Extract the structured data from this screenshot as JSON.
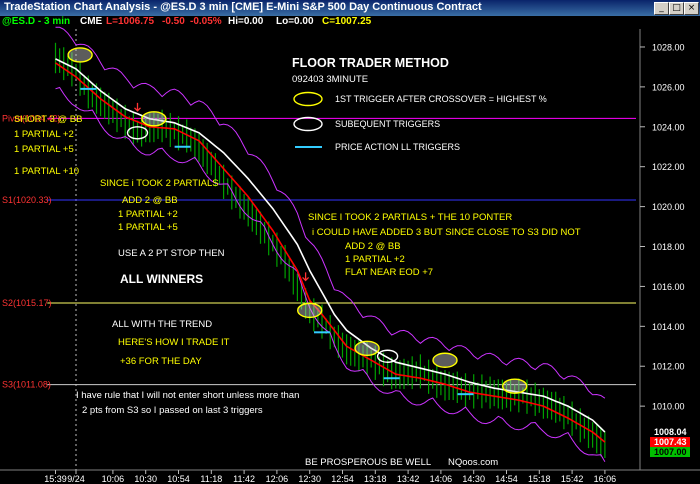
{
  "window": {
    "title": "TradeStation Chart Analysis - @ES.D  3 min  [CME] E-Mini S&P 500 Day Continuous Contract",
    "btn_min": "_",
    "btn_max": "□",
    "btn_close": "×"
  },
  "infobar": {
    "symbol": "@ES.D - 3 min",
    "exchange": "CME",
    "last": "L=1006.75",
    "chg": "-0.50",
    "pct": "-0.05%",
    "hi": "Hi=0.00",
    "lo": "Lo=0.00",
    "close": "C=1007.25"
  },
  "colors": {
    "bg": "#000000",
    "bar": "#00a000",
    "band": "#cc33ff",
    "fast_ma": "#ff0000",
    "slow_ma": "#ffffff",
    "pivot": "#ff3333",
    "text_yellow": "#ffff00",
    "trigger_cyan": "#33ccff"
  },
  "chart_data": {
    "type": "line",
    "title": "FLOOR TRADER METHOD",
    "subtitle": "092403  3MINUTE",
    "ylim": [
      1007,
      1028.5
    ],
    "y_ticks": [
      1028,
      1026,
      1024,
      1022,
      1020,
      1018,
      1016,
      1014,
      1012,
      1010
    ],
    "y_tick_labels": [
      "1028.00",
      "1026.00",
      "1024.00",
      "1022.00",
      "1020.00",
      "1018.00",
      "1016.00",
      "1014.00",
      "1012.00",
      "1010.00"
    ],
    "x_ticks": [
      {
        "label": "15:39",
        "i": -5
      },
      {
        "label": "9/24",
        "i": 0
      },
      {
        "label": "10:06",
        "i": 9
      },
      {
        "label": "10:30",
        "i": 17
      },
      {
        "label": "10:54",
        "i": 25
      },
      {
        "label": "11:18",
        "i": 33
      },
      {
        "label": "11:42",
        "i": 41
      },
      {
        "label": "12:06",
        "i": 49
      },
      {
        "label": "12:30",
        "i": 57
      },
      {
        "label": "12:54",
        "i": 65
      },
      {
        "label": "13:18",
        "i": 73
      },
      {
        "label": "13:42",
        "i": 81
      },
      {
        "label": "14:06",
        "i": 89
      },
      {
        "label": "14:30",
        "i": 97
      },
      {
        "label": "14:54",
        "i": 105
      },
      {
        "label": "15:18",
        "i": 113
      },
      {
        "label": "15:42",
        "i": 121
      },
      {
        "label": "16:06",
        "i": 129
      }
    ],
    "price_anchors": [
      [
        -5,
        1027.5
      ],
      [
        0,
        1026.8
      ],
      [
        3,
        1025.8
      ],
      [
        6,
        1025.3
      ],
      [
        9,
        1024.8
      ],
      [
        12,
        1024.3
      ],
      [
        15,
        1023.8
      ],
      [
        18,
        1024.0
      ],
      [
        21,
        1024.1
      ],
      [
        24,
        1023.8
      ],
      [
        27,
        1023.6
      ],
      [
        30,
        1023.0
      ],
      [
        33,
        1022.2
      ],
      [
        36,
        1021.3
      ],
      [
        39,
        1020.5
      ],
      [
        42,
        1019.8
      ],
      [
        45,
        1019.0
      ],
      [
        48,
        1018.2
      ],
      [
        51,
        1017.3
      ],
      [
        54,
        1016.0
      ],
      [
        57,
        1014.8
      ],
      [
        60,
        1014.3
      ],
      [
        63,
        1013.5
      ],
      [
        66,
        1012.9
      ],
      [
        69,
        1012.6
      ],
      [
        72,
        1012.4
      ],
      [
        75,
        1011.9
      ],
      [
        78,
        1011.6
      ],
      [
        81,
        1011.7
      ],
      [
        84,
        1011.8
      ],
      [
        87,
        1011.4
      ],
      [
        90,
        1011.1
      ],
      [
        93,
        1011.0
      ],
      [
        96,
        1010.8
      ],
      [
        99,
        1010.8
      ],
      [
        102,
        1010.7
      ],
      [
        105,
        1010.6
      ],
      [
        108,
        1010.6
      ],
      [
        111,
        1010.5
      ],
      [
        114,
        1010.2
      ],
      [
        117,
        1010.0
      ],
      [
        120,
        1009.6
      ],
      [
        123,
        1009.1
      ],
      [
        126,
        1008.6
      ],
      [
        129,
        1008.1
      ]
    ],
    "fast_ma_anchors": [
      [
        -5,
        1027.2
      ],
      [
        0,
        1026.5
      ],
      [
        6,
        1025.4
      ],
      [
        12,
        1024.5
      ],
      [
        18,
        1024.0
      ],
      [
        24,
        1023.9
      ],
      [
        30,
        1023.3
      ],
      [
        36,
        1021.9
      ],
      [
        42,
        1020.5
      ],
      [
        48,
        1018.8
      ],
      [
        54,
        1016.8
      ],
      [
        57,
        1015.3
      ],
      [
        60,
        1014.6
      ],
      [
        63,
        1013.8
      ],
      [
        66,
        1013.0
      ],
      [
        72,
        1012.3
      ],
      [
        78,
        1011.6
      ],
      [
        84,
        1011.4
      ],
      [
        90,
        1011.1
      ],
      [
        96,
        1010.7
      ],
      [
        102,
        1010.5
      ],
      [
        108,
        1010.3
      ],
      [
        114,
        1010.0
      ],
      [
        120,
        1009.4
      ],
      [
        126,
        1008.7
      ],
      [
        129,
        1008.2
      ]
    ],
    "slow_ma_anchors": [
      [
        -5,
        1027.4
      ],
      [
        0,
        1026.9
      ],
      [
        6,
        1025.8
      ],
      [
        12,
        1024.9
      ],
      [
        18,
        1024.4
      ],
      [
        24,
        1024.2
      ],
      [
        30,
        1023.7
      ],
      [
        36,
        1022.7
      ],
      [
        42,
        1021.4
      ],
      [
        48,
        1019.9
      ],
      [
        54,
        1018.1
      ],
      [
        57,
        1016.8
      ],
      [
        60,
        1015.7
      ],
      [
        63,
        1014.6
      ],
      [
        66,
        1013.8
      ],
      [
        72,
        1012.9
      ],
      [
        78,
        1012.2
      ],
      [
        84,
        1011.9
      ],
      [
        90,
        1011.6
      ],
      [
        96,
        1011.2
      ],
      [
        102,
        1010.9
      ],
      [
        108,
        1010.7
      ],
      [
        114,
        1010.5
      ],
      [
        120,
        1010.0
      ],
      [
        126,
        1009.3
      ],
      [
        129,
        1008.7
      ]
    ],
    "pivots": [
      {
        "label": "Pivot(1024.42)",
        "value": 1024.42
      },
      {
        "label": "S1(1020.33)",
        "value": 1020.33
      },
      {
        "label": "S2(1015.17)",
        "value": 1015.17
      },
      {
        "label": "S3(1011.08)",
        "value": 1011.08
      }
    ],
    "price_boxes": [
      {
        "value": "1008.04",
        "bg": "#000000",
        "fg": "#ffffff",
        "y": 1008.04
      },
      {
        "value": "1007.43",
        "bg": "#ff0000",
        "fg": "#ffffff",
        "y": 1007.43
      },
      {
        "value": "1007.00",
        "bg": "#00c000",
        "fg": "#000000",
        "y": 1007.0
      }
    ],
    "first_triggers": [
      {
        "i": 1,
        "y": 1027.6
      },
      {
        "i": 19,
        "y": 1024.4
      },
      {
        "i": 57,
        "y": 1014.8
      },
      {
        "i": 71,
        "y": 1012.9
      },
      {
        "i": 90,
        "y": 1012.3
      },
      {
        "i": 107,
        "y": 1011.0
      }
    ],
    "subsequent_triggers": [
      {
        "i": 15,
        "y": 1023.7
      },
      {
        "i": 76,
        "y": 1012.5
      }
    ],
    "cyan_triggers": [
      {
        "i": 3,
        "y": 1025.9
      },
      {
        "i": 26,
        "y": 1023.0
      },
      {
        "i": 60,
        "y": 1013.7
      },
      {
        "i": 77,
        "y": 1011.4
      },
      {
        "i": 95,
        "y": 1010.6
      }
    ],
    "arrows": [
      {
        "i": 15,
        "y": 1024.8
      },
      {
        "i": 56,
        "y": 1016.3
      }
    ]
  },
  "legend": {
    "first_trigger": "1ST TRIGGER AFTER CROSSOVER = HIGHEST %",
    "subsequent": "SUBEQUENT TRIGGERS",
    "price_action": "PRICE ACTION LL TRIGGERS"
  },
  "notes": {
    "short": "SHORT 3 @ BB",
    "p1": "1 PARTIAL +2",
    "p2": "1 PARTIAL +5",
    "p3": "1 PARTIAL +10",
    "since1": "SINCE i TOOK 2 PARTIALS",
    "add1": "ADD 2 @ BB",
    "add1_p1": "1 PARTIAL +2",
    "add1_p2": "1 PARTIAL +5",
    "since2": "SINCE I TOOK 2 PARTIALS + THE 10 PONTER",
    "could": "i COULD HAVE ADDED 3 BUT SINCE CLOSE TO S3 DID NOT",
    "add2": "ADD 2 @ BB",
    "add2_p1": "1 PARTIAL +2",
    "flat": "FLAT NEAR EOD +7",
    "stop": "USE A 2 PT STOP THEN",
    "all_winners": "ALL WINNERS",
    "trend": "ALL WITH THE TREND",
    "how": "HERE'S HOW I TRADE IT",
    "day": "+36 FOR THE DAY",
    "rule1": "I have rule that I will not enter short unless more  than",
    "rule2": "2 pts from S3 so I passed on last 3 triggers",
    "footer": "BE PROSPEROUS BE WELL",
    "site": "NQoos.com"
  }
}
